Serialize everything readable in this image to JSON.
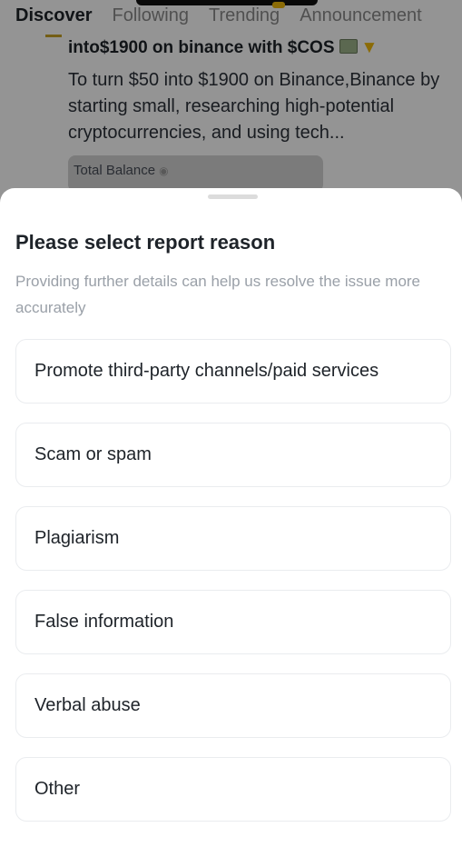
{
  "feed": {
    "tabs": [
      {
        "label": "Discover",
        "active": true
      },
      {
        "label": "Following",
        "active": false
      },
      {
        "label": "Trending",
        "active": false
      },
      {
        "label": "Announcement",
        "active": false
      }
    ],
    "post": {
      "title": "into$1900 on binance with $COS",
      "body": "To turn $50 into $1900 on Binance,Binance by starting small, researching high-potential cryptocurrencies, and using tech...",
      "balance_label": "Total Balance"
    }
  },
  "sheet": {
    "title": "Please select report reason",
    "subtitle": "Providing further details can help us resolve the issue more accurately",
    "reasons": [
      "Promote third-party channels/paid services",
      "Scam or spam",
      "Plagiarism",
      "False information",
      "Verbal abuse",
      "Other"
    ]
  },
  "colors": {
    "accent": "#f0b90b",
    "text_primary": "#1e2329",
    "text_secondary": "#9aa0a8",
    "card_border": "#eaecef"
  },
  "icons": {
    "eye": "eye-icon",
    "money": "money-emoji-icon",
    "thumb": "thumb-down-icon"
  }
}
